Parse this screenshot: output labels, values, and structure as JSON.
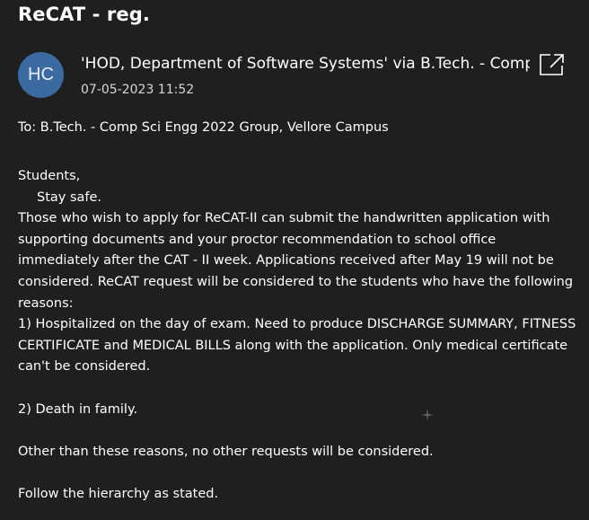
{
  "message": {
    "subject": "ReCAT - reg.",
    "avatar_initials": "HC",
    "sender": "'HOD, Department of Software Systems' via B.Tech. - Comp",
    "date": "07-05-2023 11:52",
    "to": "To: B.Tech. - Comp Sci Engg 2022 Group, Vellore Campus",
    "body_lines": [
      "Students,",
      "Stay safe.",
      "Those who wish to apply for ReCAT-II can submit the handwritten application with",
      "supporting documents and your proctor recommendation to school office",
      "immediately after the CAT - II week. Applications received after May 19 will not be",
      "considered. ReCAT request will be considered to the students who have the following",
      "reasons:",
      "1) Hospitalized on the day of exam. Need to produce DISCHARGE SUMMARY, FITNESS",
      "CERTIFICATE and MEDICAL BILLS along with the application. Only medical certificate",
      "can't be considered.",
      "",
      "2) Death in family.",
      "",
      "Other than these reasons, no other requests will be considered.",
      "",
      "Follow the hierarchy as stated."
    ]
  },
  "colors": {
    "background": "#1f1f1f",
    "avatar": "#3b6aa0",
    "text": "#ffffff"
  },
  "icons": {
    "popout": "open-in-new-window-icon"
  }
}
